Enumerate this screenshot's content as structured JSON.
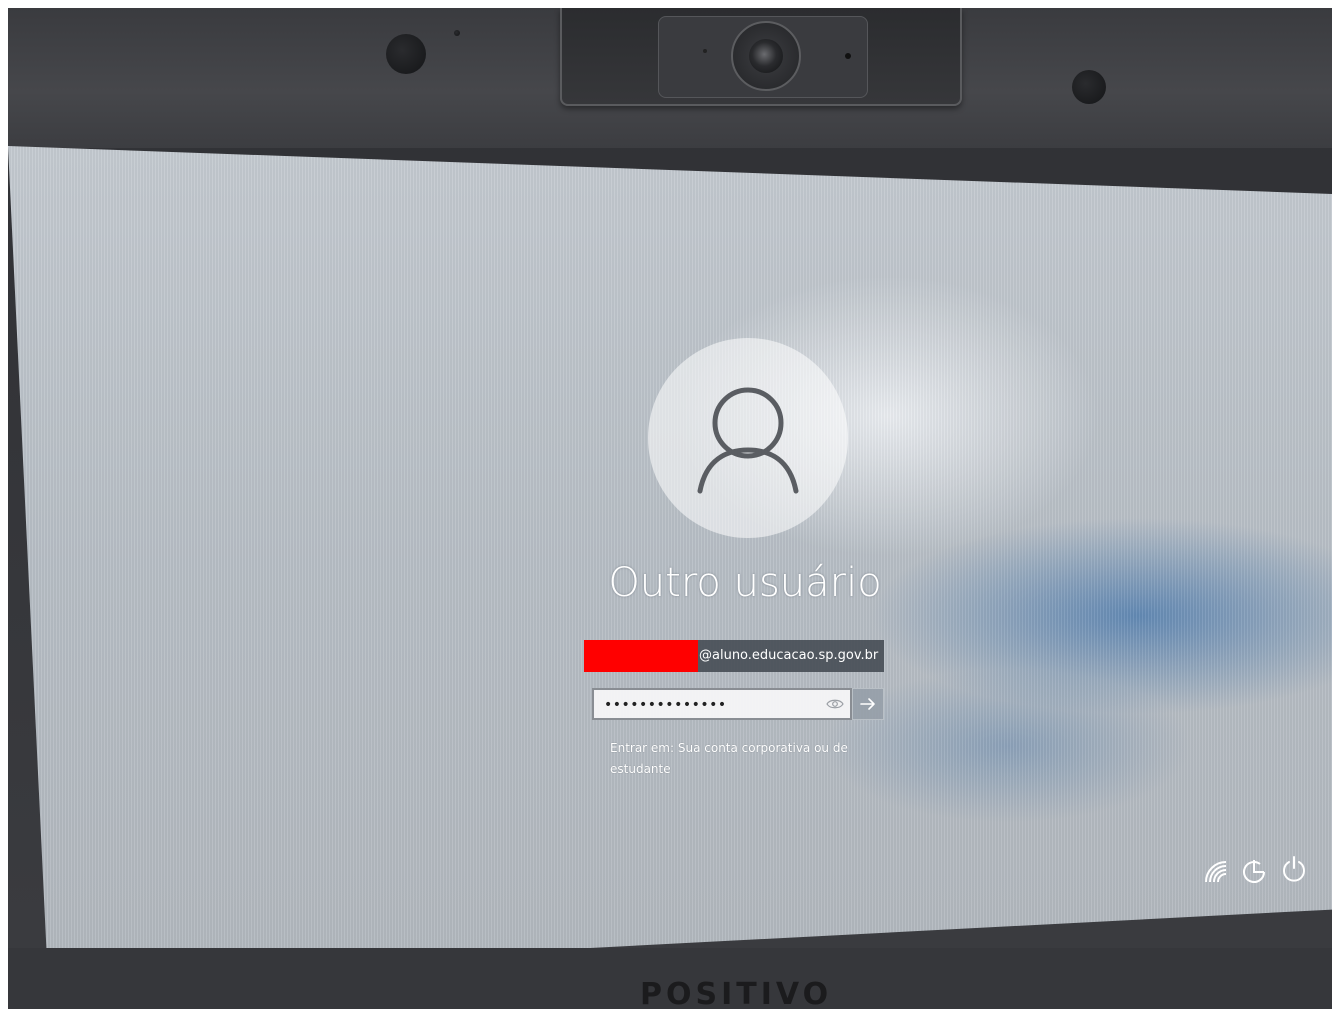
{
  "login": {
    "user_name": "Outro usuário",
    "email_domain": "@aluno.educacao.sp.gov.br",
    "password_mask": "••••••••••••••",
    "signin_hint": "Entrar em: Sua conta corporativa ou de estudante"
  },
  "device": {
    "brand": "POSITIVO"
  },
  "icons": {
    "avatar": "user-icon",
    "reveal": "eye-icon",
    "submit": "arrow-right-icon",
    "network": "wifi-icon",
    "accessibility": "ease-of-access-icon",
    "power": "power-icon"
  },
  "colors": {
    "redaction": "#ff0000",
    "background": "#bcc3c9",
    "accent_blue": "#4678af"
  }
}
